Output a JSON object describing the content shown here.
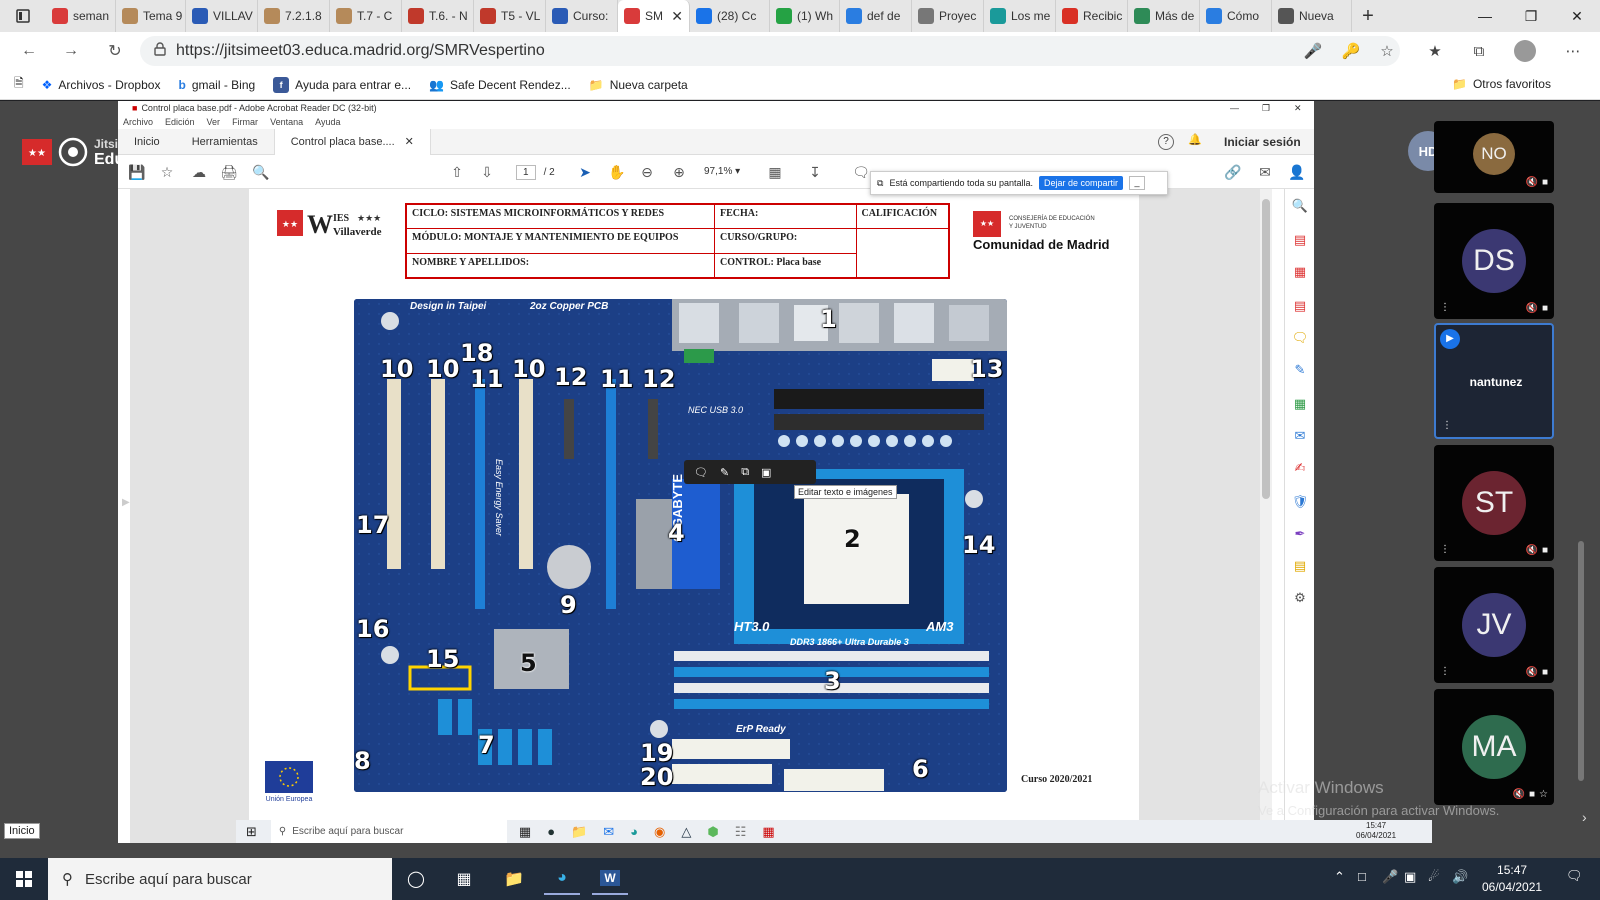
{
  "browser": {
    "tabs": [
      {
        "label": "seman",
        "color": "#d93b3b"
      },
      {
        "label": "Tema 9",
        "color": "#b58a5a"
      },
      {
        "label": "VILLAV",
        "color": "#2a5bb6"
      },
      {
        "label": "7.2.1.8",
        "color": "#b58a5a"
      },
      {
        "label": "T.7 - C",
        "color": "#b58a5a"
      },
      {
        "label": "T.6. - N",
        "color": "#c0392b"
      },
      {
        "label": "T5 - VL",
        "color": "#c0392b"
      },
      {
        "label": "Curso:",
        "color": "#2a5bb6"
      },
      {
        "label": "SM",
        "color": "#d93b3b"
      },
      {
        "label": "(28) Cc",
        "color": "#1a73e8"
      },
      {
        "label": "(1) Wh",
        "color": "#25a244"
      },
      {
        "label": "def de",
        "color": "#2a7de1"
      },
      {
        "label": "Proyec",
        "color": "#777777"
      },
      {
        "label": "Los me",
        "color": "#1a9a9a"
      },
      {
        "label": "Recibic",
        "color": "#d93025"
      },
      {
        "label": "Más de",
        "color": "#2e8b57"
      },
      {
        "label": "Cómo",
        "color": "#2a7de1"
      },
      {
        "label": "Nueva",
        "color": "#555555"
      }
    ],
    "active_tab_index": 8,
    "url": "https://jitsimeet03.educa.madrid.org/SMRVespertino",
    "favorites": [
      "Archivos - Dropbox",
      "gmail - Bing",
      "Ayuda para entrar e...",
      "Safe Decent Rendez...",
      "Nueva carpeta"
    ],
    "other_favorites": "Otros favoritos"
  },
  "meeting": {
    "brand": "Jitsi Meet",
    "brand_sub": "EducaMadrid",
    "hd_badge": "HD",
    "participants": [
      {
        "initials": "NO",
        "color": "#8a6a3f"
      },
      {
        "initials": "DS",
        "color": "#3b3872"
      },
      {
        "name": "nantunez",
        "speaker": true
      },
      {
        "initials": "ST",
        "color": "#6b2430"
      },
      {
        "initials": "JV",
        "color": "#3b3872"
      },
      {
        "initials": "MA",
        "color": "#2e6b4e"
      }
    ]
  },
  "acrobat": {
    "title": "Control placa base.pdf - Adobe Acrobat Reader DC (32-bit)",
    "menu": [
      "Archivo",
      "Edición",
      "Ver",
      "Firmar",
      "Ventana",
      "Ayuda"
    ],
    "tabs": [
      "Inicio",
      "Herramientas",
      "Control placa base...."
    ],
    "signin": "Iniciar sesión",
    "page_current": "1",
    "page_total": "/ 2",
    "zoom": "97,1%",
    "share_notice": "Está compartiendo toda su pantalla.",
    "stop_share": "Dejar de compartir",
    "edit_tooltip": "Editar texto e imágenes"
  },
  "document": {
    "school": "IES Villaverde",
    "table": {
      "ciclo": "CICLO: SISTEMAS MICROINFORMÁTICOS  Y REDES",
      "fecha": "FECHA:",
      "calificacion": "CALIFICACIÓN",
      "modulo": "MÓDULO: MONTAJE Y MANTENIMIENTO DE EQUIPOS",
      "curso_grupo": "CURSO/GRUPO:",
      "nombre": "NOMBRE Y APELLIDOS:",
      "control": "CONTROL: Placa base"
    },
    "cam_line1": "CONSEJERÍA DE EDUCACIÓN",
    "cam_line2": "Y JUVENTUD",
    "cam_name": "Comunidad de Madrid",
    "eu_text": "Unión Europea",
    "curso": "Curso 2020/2021",
    "board_labels": [
      "1",
      "2",
      "3",
      "4",
      "5",
      "6",
      "7",
      "8",
      "9",
      "10",
      "10",
      "10",
      "11",
      "11",
      "12",
      "12",
      "13",
      "14",
      "15",
      "16",
      "17",
      "18",
      "19",
      "20"
    ],
    "board_texts": {
      "design": "Design in Taipei",
      "copper": "2oz Copper PCB",
      "brand": "GIGABYTE",
      "ht": "HT3.0",
      "socket": "AM3",
      "ddr": "DDR3 1866+ Ultra Durable 3",
      "energy": "Easy Energy Saver",
      "erp": "ErP Ready",
      "usb": "NEC USB 3.0"
    }
  },
  "inner_windows": {
    "search": "Escribe aquí para buscar",
    "time": "15:47",
    "date": "06/04/2021",
    "inicio_label": "Inicio"
  },
  "watermark": {
    "line1": "Activar Windows",
    "line2": "Ve a Configuración para activar Windows."
  },
  "taskbar": {
    "search": "Escribe aquí para buscar",
    "time": "15:47",
    "date": "06/04/2021"
  }
}
